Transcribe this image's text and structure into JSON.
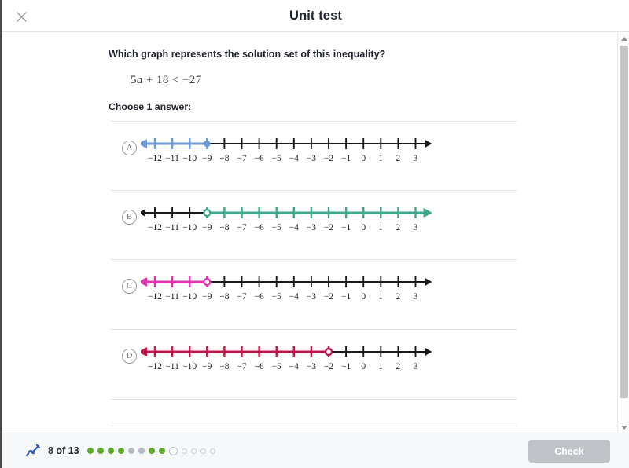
{
  "header": {
    "title": "Unit test",
    "close_icon": "close-icon"
  },
  "question": {
    "prompt": "Which graph represents the solution set of this inequality?",
    "formula_lhs_coeff": "5",
    "formula_var": "a",
    "formula_rest": " + 18 < −27",
    "formula_plain": "5a + 18 < −27",
    "choose_label": "Choose 1 answer:"
  },
  "number_line": {
    "tick_labels": [
      "−12",
      "−11",
      "−10",
      "−9",
      "−8",
      "−7",
      "−6",
      "−5",
      "−4",
      "−3",
      "−2",
      "−1",
      "0",
      "1",
      "2",
      "3"
    ],
    "min": -12,
    "max": 3,
    "axis_color": "#1a1a1a"
  },
  "options": [
    {
      "letter": "A",
      "color": "#6b9bd8",
      "endpoint": -9,
      "endpoint_style": "closed",
      "direction": "left",
      "description": "blue ray extending left from a closed circle at −9"
    },
    {
      "letter": "B",
      "color": "#3ea98a",
      "endpoint": -9,
      "endpoint_style": "open",
      "direction": "right",
      "description": "green ray extending right from an open circle at −9"
    },
    {
      "letter": "C",
      "color": "#e034b0",
      "endpoint": -9,
      "endpoint_style": "open",
      "direction": "left",
      "description": "magenta ray extending left from an open circle at −9"
    },
    {
      "letter": "D",
      "color": "#c0174a",
      "endpoint": -2,
      "endpoint_style": "open",
      "direction": "left",
      "description": "crimson ray extending left from an open circle at −2"
    }
  ],
  "footer": {
    "icon": "pencil-icon",
    "progress_text": "8 of 13",
    "check_label": "Check",
    "dots": [
      {
        "state": "correct"
      },
      {
        "state": "correct"
      },
      {
        "state": "correct"
      },
      {
        "state": "correct"
      },
      {
        "state": "skipped"
      },
      {
        "state": "skipped"
      },
      {
        "state": "correct"
      },
      {
        "state": "correct"
      },
      {
        "state": "current"
      },
      {
        "state": "unanswered"
      },
      {
        "state": "unanswered"
      },
      {
        "state": "unanswered"
      },
      {
        "state": "unanswered"
      }
    ],
    "dot_colors": {
      "correct": "#5cab2d",
      "skipped": "#b6bcc4",
      "unanswered": "#ffffff",
      "current": "#ffffff"
    }
  },
  "scrollbar": {
    "up_icon": "chevron-up-icon",
    "down_icon": "chevron-down-icon"
  }
}
